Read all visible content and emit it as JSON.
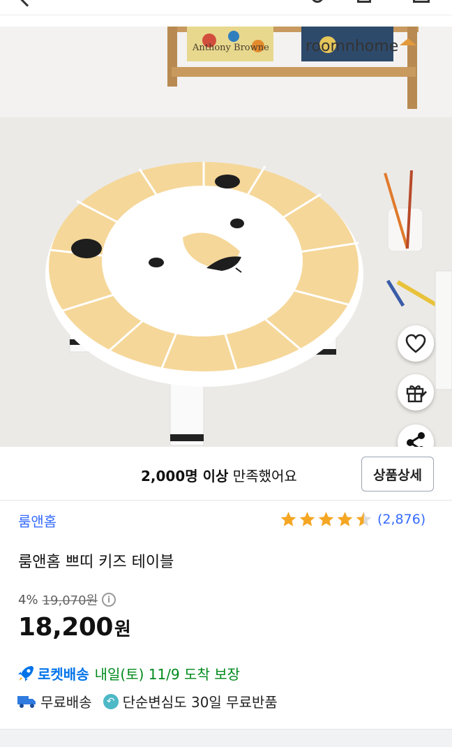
{
  "hero": {
    "brand_logo": "roomnhome",
    "book_left_text": "Anthony Browne"
  },
  "actions": {
    "heart_icon": "heart-icon",
    "gift_icon": "gift-icon",
    "share_icon": "share-icon"
  },
  "satisfaction": {
    "count": "2,000명 이상",
    "text": "만족했어요",
    "detail_button": "상품상세"
  },
  "product": {
    "brand": "룸앤홈",
    "rating": 4.5,
    "review_count": "(2,876)",
    "title": "룸앤홈 쁘띠 키즈 테이블",
    "discount_rate": "4%",
    "original_price": "19,070원",
    "price": "18,200",
    "price_unit": "원"
  },
  "delivery": {
    "rocket_label": "로켓배송",
    "eta": "내일(토) 11/9 도착 보장",
    "free_shipping": "무료배송",
    "returns": "단순변심도 30일 무료반품"
  },
  "colors": {
    "accent_blue": "#346aff",
    "rocket_blue": "#0073e9",
    "eta_green": "#00891a",
    "star_orange": "#f5a623"
  }
}
